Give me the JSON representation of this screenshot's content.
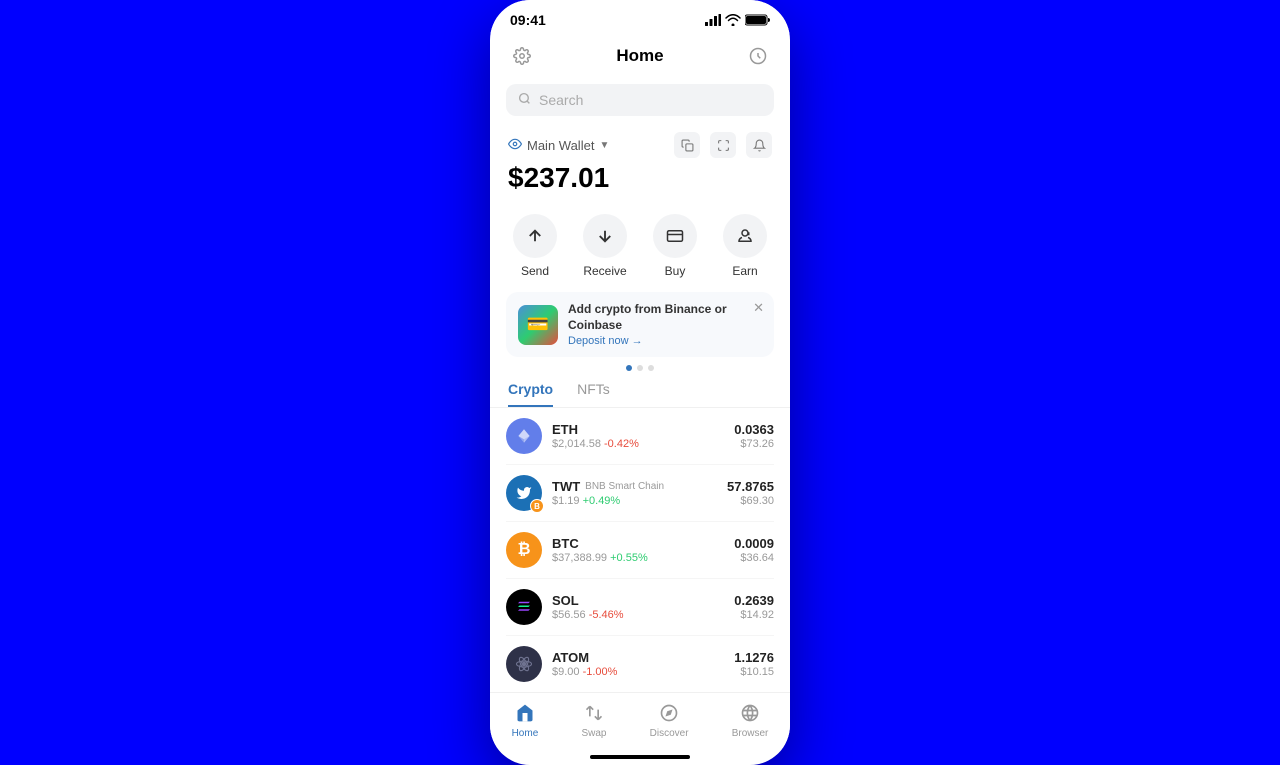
{
  "statusBar": {
    "time": "09:41",
    "signal": "signal-icon",
    "wifi": "wifi-icon",
    "battery": "battery-icon"
  },
  "header": {
    "title": "Home",
    "settingsIcon": "gear-icon",
    "walletIcon": "wallet-connect-icon"
  },
  "search": {
    "placeholder": "Search"
  },
  "wallet": {
    "name": "Main Wallet",
    "balance": "$237.01",
    "copyIcon": "copy-icon",
    "expandIcon": "expand-icon",
    "bellIcon": "bell-icon"
  },
  "actions": [
    {
      "label": "Send",
      "icon": "send-icon"
    },
    {
      "label": "Receive",
      "icon": "receive-icon"
    },
    {
      "label": "Buy",
      "icon": "buy-icon"
    },
    {
      "label": "Earn",
      "icon": "earn-icon"
    }
  ],
  "banner": {
    "title": "Add crypto from Binance or Coinbase",
    "linkText": "Deposit now →"
  },
  "tabs": [
    {
      "label": "Crypto",
      "active": true
    },
    {
      "label": "NFTs",
      "active": false
    }
  ],
  "cryptoList": [
    {
      "symbol": "ETH",
      "chain": "",
      "price": "$2,014.58",
      "change": "-0.42%",
      "changeType": "negative",
      "amount": "0.0363",
      "usdValue": "$73.26",
      "colorClass": "eth"
    },
    {
      "symbol": "TWT",
      "chain": "BNB Smart Chain",
      "price": "$1.19",
      "change": "+0.49%",
      "changeType": "positive",
      "amount": "57.8765",
      "usdValue": "$69.30",
      "colorClass": "twt"
    },
    {
      "symbol": "BTC",
      "chain": "",
      "price": "$37,388.99",
      "change": "+0.55%",
      "changeType": "positive",
      "amount": "0.0009",
      "usdValue": "$36.64",
      "colorClass": "btc"
    },
    {
      "symbol": "SOL",
      "chain": "",
      "price": "$56.56",
      "change": "-5.46%",
      "changeType": "negative",
      "amount": "0.2639",
      "usdValue": "$14.92",
      "colorClass": "sol"
    },
    {
      "symbol": "ATOM",
      "chain": "",
      "price": "$9.00",
      "change": "-1.00%",
      "changeType": "negative",
      "amount": "1.1276",
      "usdValue": "$10.15",
      "colorClass": "atom"
    }
  ],
  "bottomNav": [
    {
      "label": "Home",
      "icon": "home-icon",
      "active": true
    },
    {
      "label": "Swap",
      "icon": "swap-icon",
      "active": false
    },
    {
      "label": "Discover",
      "icon": "discover-icon",
      "active": false
    },
    {
      "label": "Browser",
      "icon": "browser-icon",
      "active": false
    }
  ]
}
